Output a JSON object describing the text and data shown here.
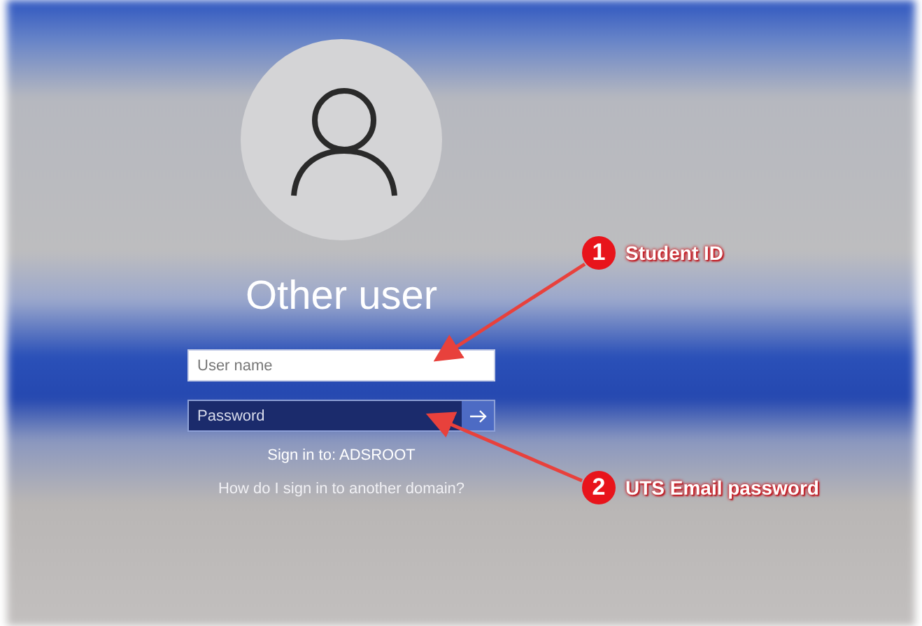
{
  "login": {
    "heading": "Other user",
    "username": {
      "placeholder": "User name"
    },
    "password": {
      "placeholder": "Password"
    },
    "sign_in_to": "Sign in to: ADSROOT",
    "help_link": "How do I sign in to another domain?"
  },
  "annotations": [
    {
      "number": "1",
      "label": "Student ID"
    },
    {
      "number": "2",
      "label": "UTS Email password"
    }
  ]
}
